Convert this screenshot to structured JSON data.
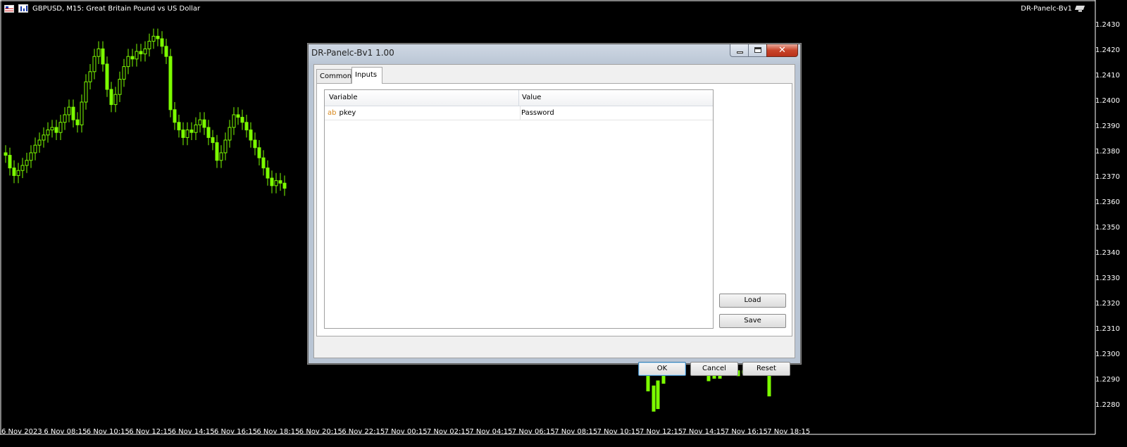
{
  "chart": {
    "symbol_title": "GBPUSD, M15:  Great Britain Pound vs US Dollar",
    "expert_label": "DR-Panelc-Bv1",
    "price_labels": [
      "1.2430",
      "1.2420",
      "1.2410",
      "1.2400",
      "1.2390",
      "1.2380",
      "1.2370",
      "1.2360",
      "1.2350",
      "1.2340",
      "1.2330",
      "1.2320",
      "1.2310",
      "1.2300",
      "1.2290",
      "1.2280"
    ],
    "time_labels": [
      "6 Nov 2023",
      "6 Nov 08:15",
      "6 Nov 10:15",
      "6 Nov 12:15",
      "6 Nov 14:15",
      "6 Nov 16:15",
      "6 Nov 18:15",
      "6 Nov 20:15",
      "6 Nov 22:15",
      "7 Nov 00:15",
      "7 Nov 02:15",
      "7 Nov 04:15",
      "7 Nov 06:15",
      "7 Nov 08:15",
      "7 Nov 10:15",
      "7 Nov 12:15",
      "7 Nov 14:15",
      "7 Nov 16:15",
      "7 Nov 18:15"
    ],
    "candle_color": "#7CFC00",
    "background": "#000000"
  },
  "dialog": {
    "title": "DR-Panelc-Bv1 1.00",
    "tabs": [
      {
        "label": "Common",
        "active": false
      },
      {
        "label": "Inputs",
        "active": true
      }
    ],
    "table": {
      "columns": [
        "Variable",
        "Value"
      ],
      "rows": [
        {
          "type_icon": "ab",
          "variable": "pkey",
          "value": "Password"
        }
      ]
    },
    "load_label": "Load",
    "save_label": "Save",
    "ok_label": "OK",
    "cancel_label": "Cancel",
    "reset_label": "Reset"
  }
}
